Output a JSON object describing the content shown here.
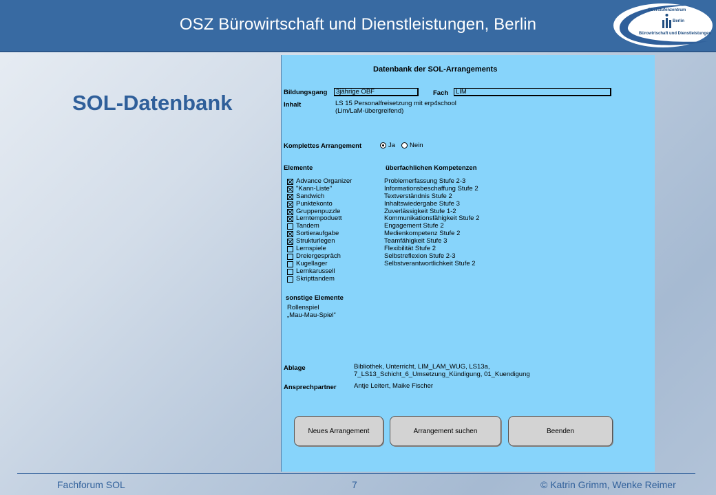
{
  "header": {
    "title": "OSZ Bürowirtschaft und Dienstleistungen, Berlin",
    "logo": {
      "line1": "Oberstufenzentrum",
      "line2": "Berlin",
      "line3": "Bürowirtschaft und Dienstleistungen",
      "icon": "osz-logo"
    }
  },
  "slide_title": "SOL-Datenbank",
  "form": {
    "title": "Datenbank der SOL-Arrangements",
    "bildungsgang_label": "Bildungsgang",
    "bildungsgang_value": "3jährige OBF",
    "fach_label": "Fach",
    "fach_value": "LIM",
    "inhalt_label": "Inhalt",
    "inhalt_line1": "LS 15 Personalfreisetzung mit erp4school",
    "inhalt_line2": "(Lim/LaM-übergreifend)",
    "komplett_label": "Komplettes Arrangement",
    "radio_ja": "Ja",
    "radio_nein": "Nein",
    "elemente_label": "Elemente",
    "kompetenzen_label": "überfachlichen Kompetenzen",
    "elemente": [
      {
        "label": "Advance Organizer",
        "checked": true
      },
      {
        "label": "\"Kann-Liste\"",
        "checked": true
      },
      {
        "label": "Sandwich",
        "checked": true
      },
      {
        "label": "Punktekonto",
        "checked": true
      },
      {
        "label": "Gruppenpuzzle",
        "checked": true
      },
      {
        "label": "Lerntempoduett",
        "checked": true
      },
      {
        "label": "Tandem",
        "checked": false
      },
      {
        "label": "Sortieraufgabe",
        "checked": true
      },
      {
        "label": "Strukturlegen",
        "checked": true
      },
      {
        "label": "Lernspiele",
        "checked": false
      },
      {
        "label": "Dreiergespräch",
        "checked": false
      },
      {
        "label": "Kugellager",
        "checked": false
      },
      {
        "label": "Lernkarussell",
        "checked": false
      },
      {
        "label": "Skripttandem",
        "checked": false
      }
    ],
    "kompetenzen": [
      "Problemerfassung Stufe 2-3",
      "Informationsbeschaffung Stufe 2",
      "Textverständnis Stufe 2",
      "Inhaltswiedergabe Stufe 3",
      "Zuverlässigkeit Stufe 1-2",
      "Kommunikationsfähigkeit Stufe 2",
      "Engagement Stufe 2",
      "Medienkompetenz Stufe 2",
      "Teamfähigkeit Stufe 3",
      "Flexibilität Stufe 2",
      "Selbstreflexion Stufe 2-3",
      "Selbstverantwortlichkeit Stufe 2"
    ],
    "sonstige_label": "sonstige Elemente",
    "sonstige_line1": "Rollenspiel",
    "sonstige_line2": "„Mau-Mau-Spiel“",
    "ablage_label": "Ablage",
    "ablage_line1": "Bibliothek, Unterricht, LIM_LAM_WUG, LS13a,",
    "ablage_line2": "7_LS13_Schicht_6_Umsetzung_Kündigung, 01_Kuendigung",
    "ansprech_label": "Ansprechpartner",
    "ansprech_value": "Antje Leitert, Maike Fischer",
    "buttons": {
      "neu": "Neues Arrangement",
      "suchen": "Arrangement suchen",
      "beenden": "Beenden"
    }
  },
  "footer": {
    "left": "Fachforum SOL",
    "page": "7",
    "right": "© Katrin Grimm, Wenke Reimer"
  }
}
